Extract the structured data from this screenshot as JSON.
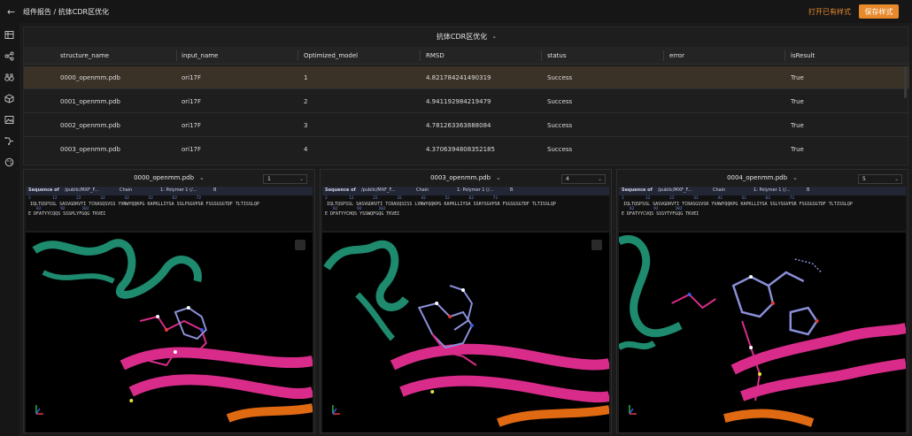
{
  "header": {
    "back_icon": "arrow-left-icon",
    "breadcrumb": "组件报告 / 抗体CDR区优化",
    "open_button": "打开已有样式",
    "save_button": "保存样式",
    "accent_color": "#e8892c"
  },
  "sidebar": {
    "icons": [
      "table-icon",
      "share-nodes-icon",
      "binoculars-icon",
      "cube-icon",
      "image-icon",
      "pipeline-icon",
      "palette-icon"
    ]
  },
  "table": {
    "title": "抗体CDR区优化",
    "columns": [
      "structure_name",
      "input_name",
      "Optimized_model",
      "RMSD",
      "status",
      "error",
      "isResult"
    ],
    "rows": [
      [
        "0000_openmm.pdb",
        "ori17F",
        "1",
        "4.821784241490319",
        "Success",
        "",
        "True"
      ],
      [
        "0001_openmm.pdb",
        "ori17F",
        "2",
        "4.941192984219479",
        "Success",
        "",
        "True"
      ],
      [
        "0002_openmm.pdb",
        "ori17F",
        "3",
        "4.781263363888084",
        "Success",
        "",
        "True"
      ],
      [
        "0003_openmm.pdb",
        "ori17F",
        "4",
        "4.3706394808352185",
        "Success",
        "",
        "True"
      ]
    ],
    "selected_row": 0
  },
  "viewers": [
    {
      "title": "0000_openmm.pdb",
      "model_select": "1",
      "seq_label": "Sequence of",
      "seq_path": "/public/MXF_F...",
      "chain_label": "Chain",
      "polymer": "1: Polymer 1 (/...",
      "chain_value": "B",
      "seq_nums_top": "2         12        22        32        42        52        62        72",
      "seq_line1": "IQLTQSPSSL SASVGDRVTI TCRASQSVSS YVNWYQQKPG KAPKLLIYSA SSLPSGVPSR FSGSGSGTDF TLTISSLQP",
      "seq_nums_mid": "82        92       102",
      "seq_line2": "E DFATYYCQQS SSSPLYFGQG TKVEI"
    },
    {
      "title": "0003_openmm.pdb",
      "model_select": "4",
      "seq_label": "Sequence of",
      "seq_path": "/public/MXF_F...",
      "chain_label": "Chain",
      "polymer": "1: Polymer 1 (/...",
      "chain_value": "B",
      "seq_nums_top": "2         12        22        32        42        52        62        72",
      "seq_line1": "IQLTQSPSSL SASVGDRVTI TCRASQSISS LVNWYQQKPG KAPKLLIYSA SSRYSGVPSR FSGSGSGTDF TLTISSLQP",
      "seq_nums_mid": "82        92       102",
      "seq_line2": "E DFATYYCHQS YSSWQFGQG TKVEI"
    },
    {
      "title": "0004_openmm.pdb",
      "model_select": "5",
      "seq_label": "Sequence of",
      "seq_path": "/public/MXF_F...",
      "chain_label": "Chain",
      "polymer": "1: Polymer 1 (/...",
      "chain_value": "B",
      "seq_nums_top": "2         12        22        32        42        52        62        72",
      "seq_line1": "IQLTQSPSSL SASVGDRVTI TCRASGSVSR YVAWYQQKPG KAPKLLIYSA SSLYSGVPSR FSGSGSGTDF TLTISSLQP",
      "seq_nums_mid": "82        92       102",
      "seq_line2": "E DFATYYCVQS SSSYTYFGQG TKVEI"
    }
  ],
  "colors": {
    "ribbon_teal": "#1e8a6e",
    "ribbon_pink": "#d92c8a",
    "ribbon_orange": "#e06a12",
    "ligand_blue": "#8a8fd8"
  }
}
